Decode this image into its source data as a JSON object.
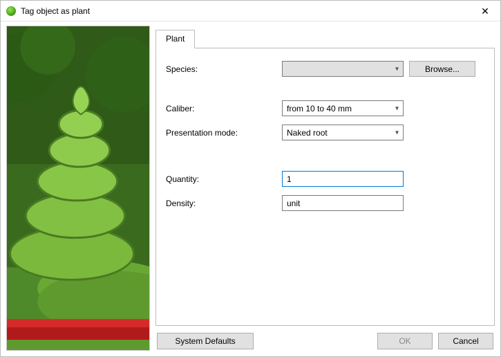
{
  "window": {
    "title": "Tag object as plant"
  },
  "tab": {
    "label": "Plant"
  },
  "fields": {
    "species": {
      "label": "Species:",
      "value": "",
      "browse": "Browse..."
    },
    "caliber": {
      "label": "Caliber:",
      "value": "from 10 to 40 mm"
    },
    "presentation": {
      "label": "Presentation mode:",
      "value": "Naked root"
    },
    "quantity": {
      "label": "Quantity:",
      "value": "1"
    },
    "density": {
      "label": "Density:",
      "value": "unit"
    }
  },
  "buttons": {
    "system_defaults": "System Defaults",
    "ok": "OK",
    "cancel": "Cancel"
  },
  "colors": {
    "field_focus": "#0078d7",
    "button_bg": "#e1e1e1",
    "border": "#bcbcbc"
  }
}
